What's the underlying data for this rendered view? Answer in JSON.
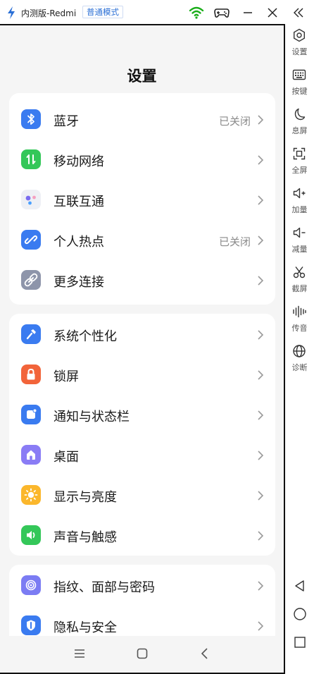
{
  "window": {
    "title": "内测版-Redmi",
    "mode_badge": "普通模式"
  },
  "page": {
    "title": "设置"
  },
  "groups": [
    {
      "items": [
        {
          "label": "蓝牙",
          "value": "已关闭",
          "icon": "bluetooth-icon",
          "color": "#3a7bf0"
        },
        {
          "label": "移动网络",
          "value": "",
          "icon": "mobile-data-icon",
          "color": "#34c759"
        },
        {
          "label": "互联互通",
          "value": "",
          "icon": "interconnect-icon",
          "color": "#eef0f5"
        },
        {
          "label": "个人热点",
          "value": "已关闭",
          "icon": "hotspot-icon",
          "color": "#3a7bf0"
        },
        {
          "label": "更多连接",
          "value": "",
          "icon": "more-connections-icon",
          "color": "#8e95aa"
        }
      ]
    },
    {
      "items": [
        {
          "label": "系统个性化",
          "value": "",
          "icon": "personalization-icon",
          "color": "#3a7bf0"
        },
        {
          "label": "锁屏",
          "value": "",
          "icon": "lock-icon",
          "color": "#f2643a"
        },
        {
          "label": "通知与状态栏",
          "value": "",
          "icon": "notification-icon",
          "color": "#3a7bf0"
        },
        {
          "label": "桌面",
          "value": "",
          "icon": "home-screen-icon",
          "color": "#8a7cf5"
        },
        {
          "label": "显示与亮度",
          "value": "",
          "icon": "brightness-icon",
          "color": "#fbb72c"
        },
        {
          "label": "声音与触感",
          "value": "",
          "icon": "sound-icon",
          "color": "#34c759"
        }
      ]
    },
    {
      "items": [
        {
          "label": "指纹、面部与密码",
          "value": "",
          "icon": "fingerprint-icon",
          "color": "#7b7cf3"
        },
        {
          "label": "隐私与安全",
          "value": "",
          "icon": "privacy-icon",
          "color": "#3a7bf0"
        }
      ]
    }
  ],
  "tools": [
    {
      "label": "设置",
      "icon": "settings-icon"
    },
    {
      "label": "按键",
      "icon": "keyboard-icon"
    },
    {
      "label": "息屏",
      "icon": "moon-icon"
    },
    {
      "label": "全屏",
      "icon": "fullscreen-icon"
    },
    {
      "label": "加量",
      "icon": "volume-up-icon"
    },
    {
      "label": "减量",
      "icon": "volume-down-icon"
    },
    {
      "label": "截屏",
      "icon": "scissors-icon"
    },
    {
      "label": "传音",
      "icon": "audio-wave-icon"
    },
    {
      "label": "诊断",
      "icon": "globe-icon"
    }
  ],
  "colors": {
    "accent": "#2a6fd6",
    "wifi": "#1aad19",
    "page_bg": "#f5f5f5",
    "card_bg": "#ffffff"
  }
}
